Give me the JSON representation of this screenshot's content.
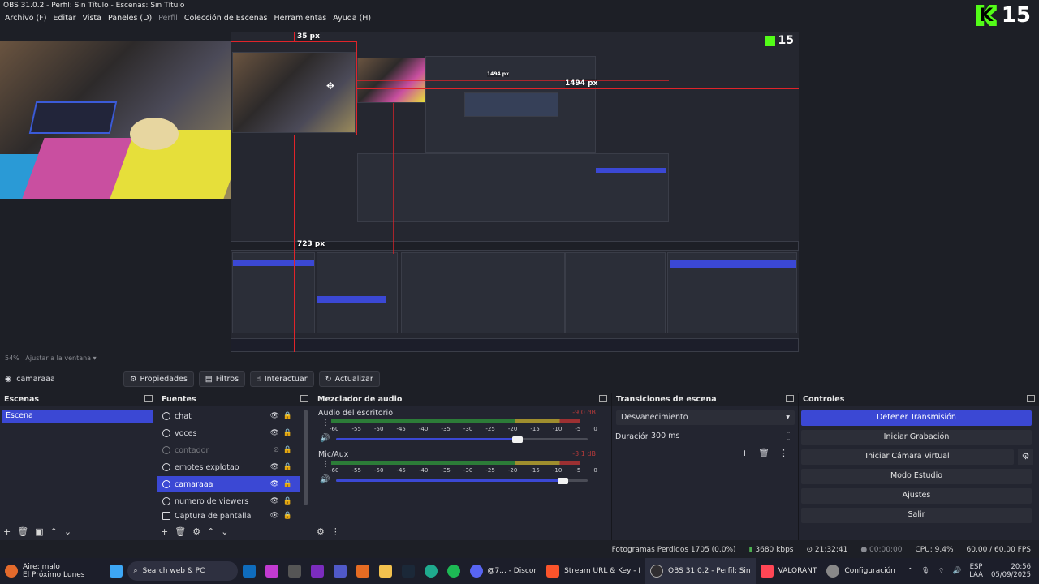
{
  "window_title": "OBS 31.0.2 - Perfil: Sin Título - Escenas: Sin Título",
  "menu": [
    "Archivo (F)",
    "Editar",
    "Vista",
    "Paneles (D)",
    "Perfil",
    "Colección de Escenas",
    "Herramientas",
    "Ayuda (H)"
  ],
  "kick_count": "15",
  "nested_kick_count": "15",
  "measure": {
    "top": "35 px",
    "right": "1494 px",
    "inner_right": "1494 px",
    "bottom": "723 px"
  },
  "zoom": {
    "percent": "54%",
    "mode": "Ajustar a la ventana"
  },
  "toolbar": {
    "source_name": "camaraaa",
    "properties": "Propiedades",
    "filters": "Filtros",
    "interact": "Interactuar",
    "refresh": "Actualizar"
  },
  "docks": {
    "scenes": {
      "title": "Escenas",
      "items": [
        "Escena"
      ]
    },
    "sources": {
      "title": "Fuentes",
      "items": [
        {
          "name": "chat",
          "state": "normal"
        },
        {
          "name": "voces",
          "state": "normal"
        },
        {
          "name": "contador",
          "state": "hidden"
        },
        {
          "name": "emotes explotao",
          "state": "normal"
        },
        {
          "name": "camaraaa",
          "state": "selected"
        },
        {
          "name": "numero de viewers",
          "state": "normal"
        },
        {
          "name": "Captura de pantalla",
          "state": "normal"
        }
      ]
    },
    "mixer": {
      "title": "Mezclador de audio",
      "channels": [
        {
          "name": "Audio del escritorio",
          "db": "-9.0 dB",
          "level": 0.72
        },
        {
          "name": "Mic/Aux",
          "db": "-3.1 dB",
          "level": 0.9
        }
      ],
      "ticks": [
        "-60",
        "-55",
        "-50",
        "-45",
        "-40",
        "-35",
        "-30",
        "-25",
        "-20",
        "-15",
        "-10",
        "-5",
        "0"
      ]
    },
    "transitions": {
      "title": "Transiciones de escena",
      "selected": "Desvanecimiento",
      "duration_label": "Duración",
      "duration_value": "300 ms"
    },
    "controls": {
      "title": "Controles",
      "buttons": [
        "Detener Transmisión",
        "Iniciar Grabación",
        "Iniciar Cámara Virtual",
        "Modo Estudio",
        "Ajustes",
        "Salir"
      ]
    }
  },
  "status": {
    "dropped": "Fotogramas Perdidos 1705 (0.0%)",
    "bitrate": "3680 kbps",
    "stream_time": "21:32:41",
    "rec_time": "00:00:00",
    "cpu": "CPU: 9.4%",
    "fps": "60.00 / 60.00 FPS"
  },
  "taskbar": {
    "weather_line1": "Aire: malo",
    "weather_line2": "El Próximo Lunes",
    "search": "Search web & PC",
    "apps": [
      "@7... - Discor",
      "Stream URL & Key - I",
      "OBS 31.0.2 - Perfil: Sin",
      "VALORANT",
      "Configuración"
    ],
    "lang": "ESP",
    "region": "LAA",
    "time": "20:56",
    "date": "05/09/2025"
  },
  "colors": {
    "accent": "#3b48d4",
    "kick": "#53fc18",
    "guide": "#e0242a",
    "bg": "#1d1f26"
  }
}
